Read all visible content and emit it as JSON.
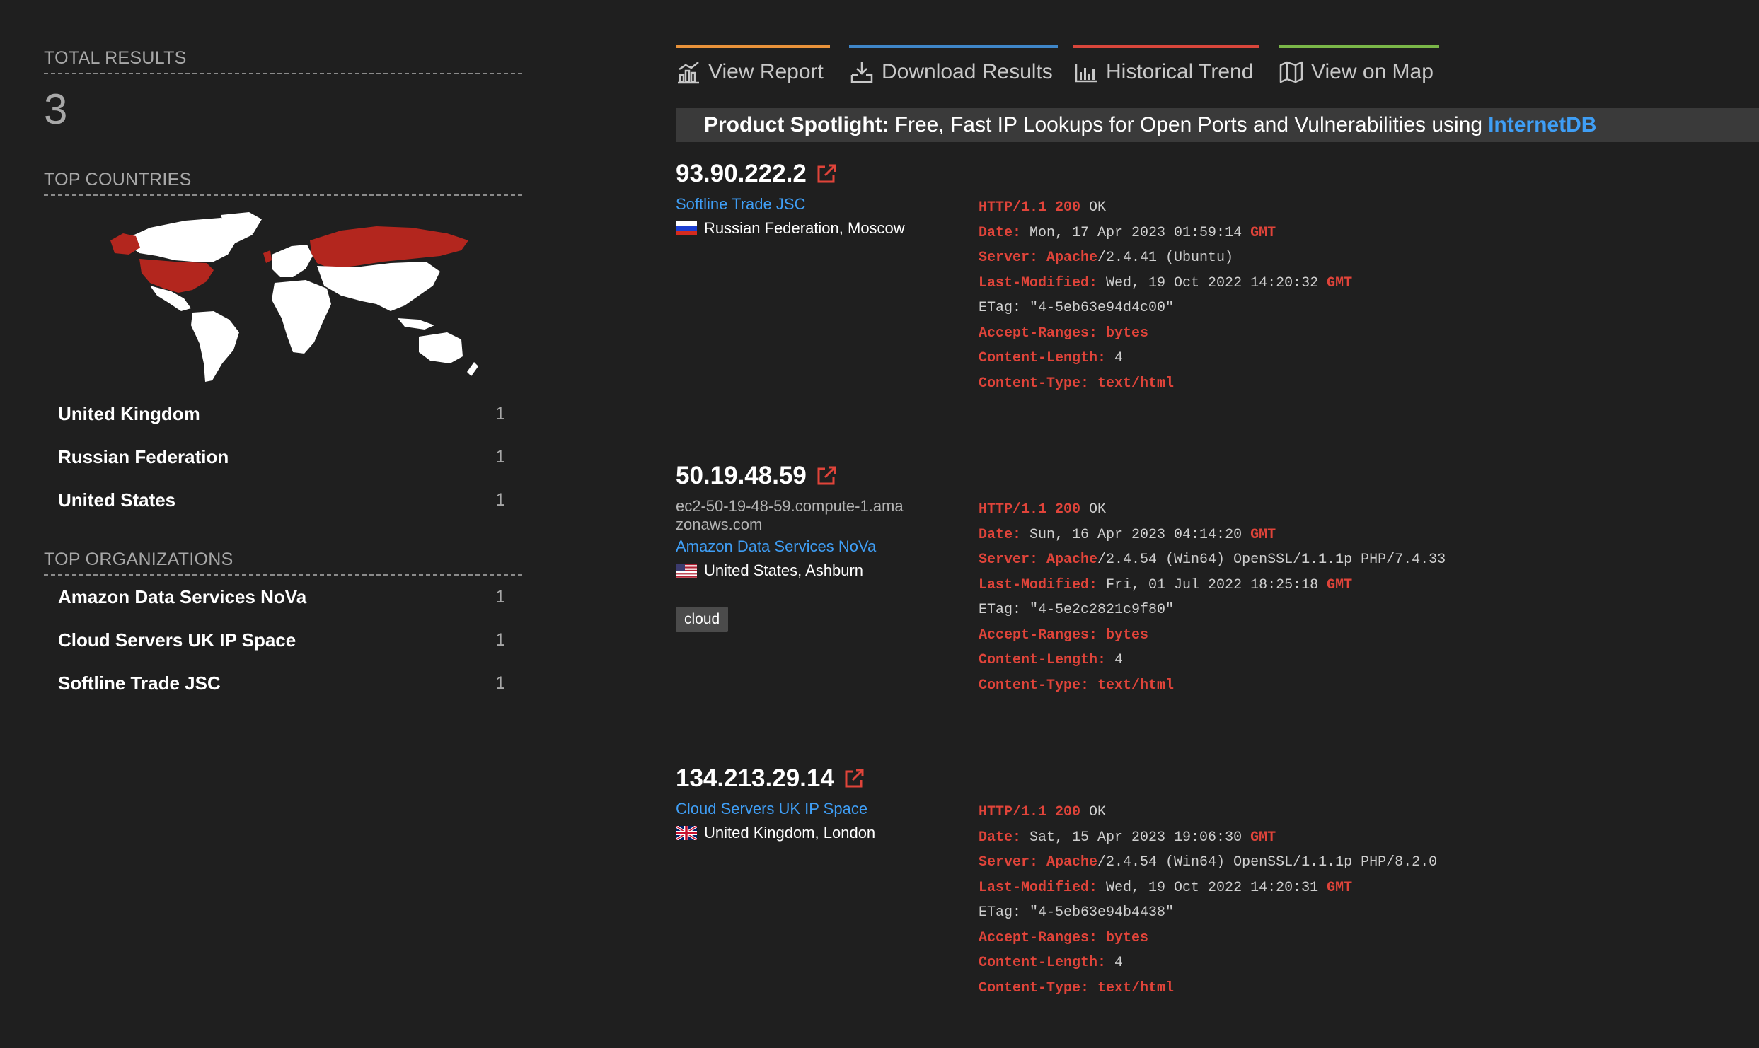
{
  "sidebar": {
    "total_label": "TOTAL RESULTS",
    "total_value": "3",
    "countries_label": "TOP COUNTRIES",
    "countries": [
      {
        "name": "United Kingdom",
        "count": "1"
      },
      {
        "name": "Russian Federation",
        "count": "1"
      },
      {
        "name": "United States",
        "count": "1"
      }
    ],
    "orgs_label": "TOP ORGANIZATIONS",
    "orgs": [
      {
        "name": "Amazon Data Services NoVa",
        "count": "1"
      },
      {
        "name": "Cloud Servers UK IP Space",
        "count": "1"
      },
      {
        "name": "Softline Trade JSC",
        "count": "1"
      }
    ]
  },
  "tabs": [
    {
      "label": "View Report",
      "color": "#e8923a",
      "icon": "bar-chart-icon"
    },
    {
      "label": "Download Results",
      "color": "#3f86c8",
      "icon": "download-icon"
    },
    {
      "label": "Historical Trend",
      "color": "#d9463b",
      "icon": "trend-chart-icon"
    },
    {
      "label": "View on Map",
      "color": "#7ab648",
      "icon": "map-icon"
    }
  ],
  "spotlight": {
    "prefix": "Product Spotlight:",
    "text": "Free, Fast IP Lookups for Open Ports and Vulnerabilities using",
    "link": "InternetDB"
  },
  "results": [
    {
      "ip": "93.90.222.2",
      "org": "Softline Trade JSC",
      "country": "Russian Federation",
      "city": "Moscow",
      "loc_text": "Russian Federation, Moscow",
      "flag": "ru",
      "banner": [
        {
          "k": "HTTP/1.1 200",
          "v": " OK"
        },
        {
          "k": "Date:",
          "v": " Mon, 17 Apr 2023 01:59:14 ",
          "k2": "GMT"
        },
        {
          "k": "Server: Apache",
          "v": "/2.4.41 (Ubuntu)"
        },
        {
          "k": "Last-Modified:",
          "v": " Wed, 19 Oct 2022 14:20:32 ",
          "k2": "GMT"
        },
        {
          "k": "",
          "v": "ETag: \"4-5eb63e94d4c00\""
        },
        {
          "k": "Accept-Ranges: bytes",
          "v": ""
        },
        {
          "k": "Content-Length:",
          "v": " 4"
        },
        {
          "k": "Content-Type: text/html",
          "v": ""
        }
      ]
    },
    {
      "ip": "50.19.48.59",
      "hostname": "ec2-50-19-48-59.compute-1.amazonaws.com",
      "org": "Amazon Data Services NoVa",
      "loc_text": "United States, Ashburn",
      "flag": "us",
      "tag": "cloud",
      "banner": [
        {
          "k": "HTTP/1.1 200",
          "v": " OK"
        },
        {
          "k": "Date:",
          "v": " Sun, 16 Apr 2023 04:14:20 ",
          "k2": "GMT"
        },
        {
          "k": "Server: Apache",
          "v": "/2.4.54 (Win64) OpenSSL/1.1.1p PHP/7.4.33"
        },
        {
          "k": "Last-Modified:",
          "v": " Fri, 01 Jul 2022 18:25:18 ",
          "k2": "GMT"
        },
        {
          "k": "",
          "v": "ETag: \"4-5e2c2821c9f80\""
        },
        {
          "k": "Accept-Ranges: bytes",
          "v": ""
        },
        {
          "k": "Content-Length:",
          "v": " 4"
        },
        {
          "k": "Content-Type: text/html",
          "v": ""
        }
      ]
    },
    {
      "ip": "134.213.29.14",
      "org": "Cloud Servers UK IP Space",
      "loc_text": "United Kingdom, London",
      "flag": "gb",
      "banner": [
        {
          "k": "HTTP/1.1 200",
          "v": " OK"
        },
        {
          "k": "Date:",
          "v": " Sat, 15 Apr 2023 19:06:30 ",
          "k2": "GMT"
        },
        {
          "k": "Server: Apache",
          "v": "/2.4.54 (Win64) OpenSSL/1.1.1p PHP/8.2.0"
        },
        {
          "k": "Last-Modified:",
          "v": " Wed, 19 Oct 2022 14:20:31 ",
          "k2": "GMT"
        },
        {
          "k": "",
          "v": "ETag: \"4-5eb63e94b4438\""
        },
        {
          "k": "Accept-Ranges: bytes",
          "v": ""
        },
        {
          "k": "Content-Length:",
          "v": " 4"
        },
        {
          "k": "Content-Type: text/html",
          "v": ""
        }
      ]
    }
  ],
  "colors": {
    "accent_link": "#3f9ef5",
    "banner_key": "#e0443a",
    "map_highlight": "#b3261e",
    "map_land": "#ffffff"
  }
}
